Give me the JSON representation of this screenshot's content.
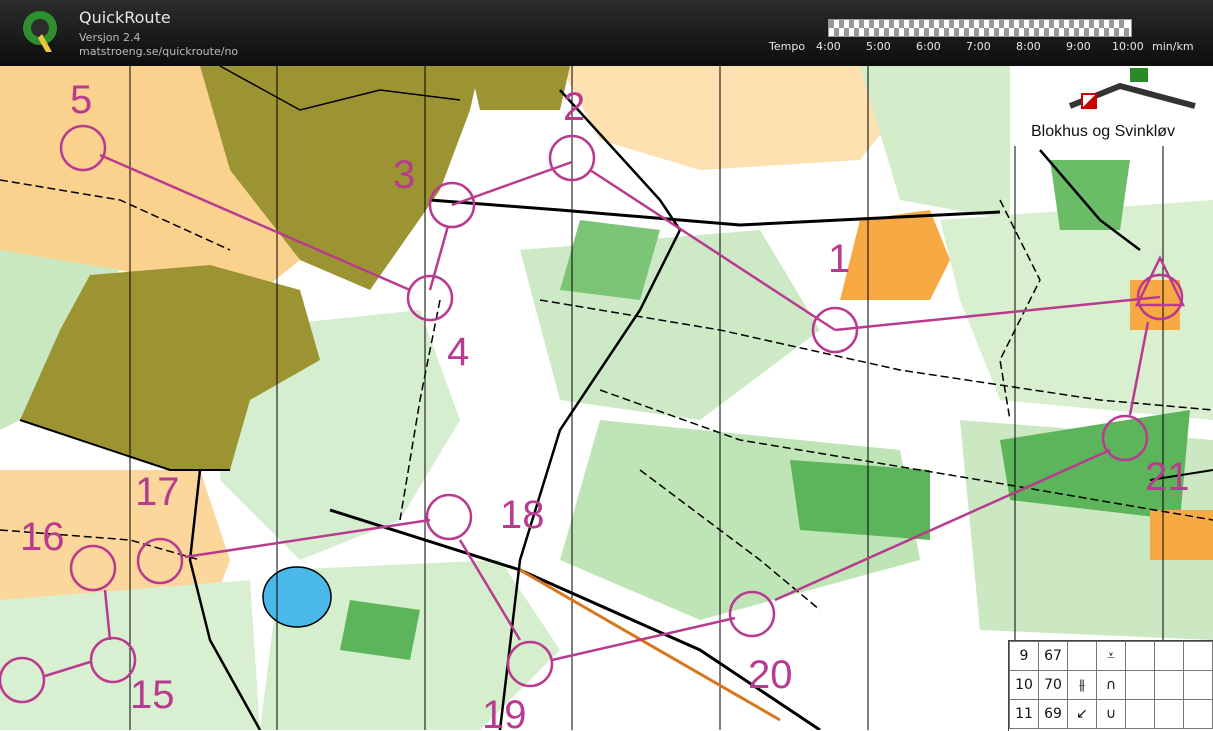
{
  "app": {
    "title": "QuickRoute",
    "version": "Versjon 2.4",
    "url": "matstroeng.se/quickroute/no"
  },
  "tempo": {
    "label": "Tempo",
    "ticks": [
      "4:00",
      "5:00",
      "6:00",
      "7:00",
      "8:00",
      "9:00",
      "10:00"
    ],
    "unit": "min/km"
  },
  "map": {
    "title": "Blokhus og Svinkløv",
    "control_labels": [
      "1",
      "2",
      "3",
      "4",
      "5",
      "15",
      "16",
      "17",
      "18",
      "19",
      "20",
      "21"
    ],
    "course_color": "#b83b8f"
  },
  "legend": {
    "rows": [
      {
        "num": "9",
        "code": "67"
      },
      {
        "num": "10",
        "code": "70"
      },
      {
        "num": "11",
        "code": "69"
      }
    ]
  }
}
